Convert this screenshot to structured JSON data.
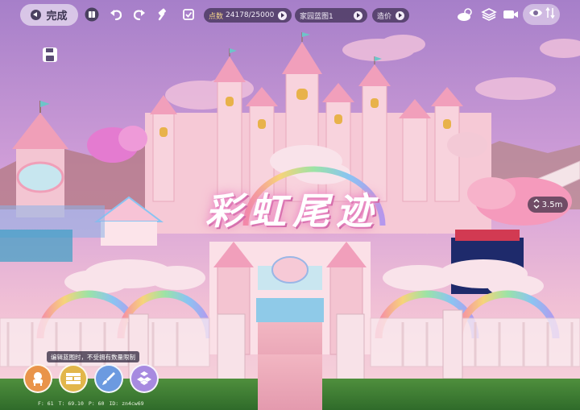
{
  "colors": {
    "sky_top": "#a67fc9",
    "sky_mid": "#d7a6dd",
    "castle_pink": "#f6c6d3",
    "castle_light": "#fbe4ea",
    "title_glow": "#e67ab8",
    "pill_bg": "#3c2e50"
  },
  "toolbar": {
    "done_label": "完成",
    "budget_label": "点数",
    "budget_value": "24178/25000",
    "blueprint_label": "家园蓝图1",
    "cost_label": "造价"
  },
  "icons": {
    "done": "back-circle-icon",
    "catalog": "book-icon",
    "undo": "undo-icon",
    "redo": "redo-icon",
    "hammer": "hammer-icon",
    "checklist": "checklist-icon",
    "weather": "weather-icon",
    "layers": "layers-icon",
    "camera": "video-camera-icon",
    "view": "eye-icon",
    "sort": "sort-arrows-icon",
    "save": "save-icon",
    "zoom": "zoom-arrows-icon"
  },
  "scene": {
    "title": "彩虹尾迹",
    "zoom_value": "3.5m"
  },
  "bottom": {
    "notice": "编辑蓝图时，不受拥有数量限制",
    "tools": [
      {
        "icon": "furniture-icon"
      },
      {
        "icon": "brick-wall-icon"
      },
      {
        "icon": "paint-brush-icon"
      },
      {
        "icon": "boxes-icon"
      }
    ],
    "debug": {
      "f": "F: 61",
      "t": "T: 69.10",
      "p": "P: 60",
      "id": "ID: zn4cw69"
    }
  }
}
